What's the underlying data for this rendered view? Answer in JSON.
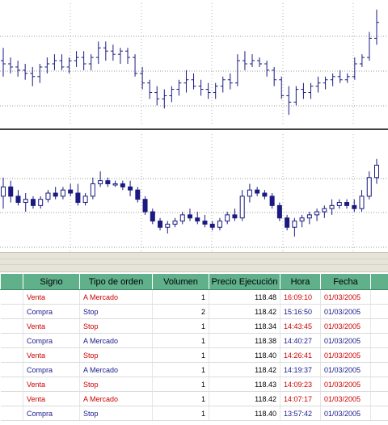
{
  "colors": {
    "header_bg": "#60b08c",
    "venta": "#cc0000",
    "compra": "#1a1a8c",
    "bar_color": "#1a1a80",
    "grid": "#9a9a9a",
    "divider": "#000000"
  },
  "chart_data": [
    {
      "type": "ohlc",
      "grid": true,
      "candles": [
        {
          "open": 118.32,
          "high": 118.36,
          "low": 118.27,
          "close": 118.31
        },
        {
          "open": 118.31,
          "high": 118.33,
          "low": 118.28,
          "close": 118.3
        },
        {
          "open": 118.3,
          "high": 118.32,
          "low": 118.27,
          "close": 118.29
        },
        {
          "open": 118.29,
          "high": 118.31,
          "low": 118.26,
          "close": 118.28
        },
        {
          "open": 118.28,
          "high": 118.3,
          "low": 118.24,
          "close": 118.27
        },
        {
          "open": 118.27,
          "high": 118.31,
          "low": 118.25,
          "close": 118.3
        },
        {
          "open": 118.3,
          "high": 118.33,
          "low": 118.28,
          "close": 118.31
        },
        {
          "open": 118.31,
          "high": 118.34,
          "low": 118.29,
          "close": 118.32
        },
        {
          "open": 118.32,
          "high": 118.34,
          "low": 118.29,
          "close": 118.3
        },
        {
          "open": 118.3,
          "high": 118.33,
          "low": 118.28,
          "close": 118.32
        },
        {
          "open": 118.32,
          "high": 118.35,
          "low": 118.3,
          "close": 118.33
        },
        {
          "open": 118.33,
          "high": 118.35,
          "low": 118.29,
          "close": 118.31
        },
        {
          "open": 118.31,
          "high": 118.34,
          "low": 118.29,
          "close": 118.33
        },
        {
          "open": 118.33,
          "high": 118.38,
          "low": 118.31,
          "close": 118.36
        },
        {
          "open": 118.36,
          "high": 118.38,
          "low": 118.32,
          "close": 118.35
        },
        {
          "open": 118.35,
          "high": 118.37,
          "low": 118.32,
          "close": 118.34
        },
        {
          "open": 118.34,
          "high": 118.36,
          "low": 118.31,
          "close": 118.35
        },
        {
          "open": 118.35,
          "high": 118.36,
          "low": 118.31,
          "close": 118.33
        },
        {
          "open": 118.33,
          "high": 118.34,
          "low": 118.27,
          "close": 118.28
        },
        {
          "open": 118.28,
          "high": 118.3,
          "low": 118.23,
          "close": 118.25
        },
        {
          "open": 118.25,
          "high": 118.26,
          "low": 118.2,
          "close": 118.22
        },
        {
          "open": 118.22,
          "high": 118.24,
          "low": 118.18,
          "close": 118.2
        },
        {
          "open": 118.2,
          "high": 118.23,
          "low": 118.17,
          "close": 118.21
        },
        {
          "open": 118.21,
          "high": 118.24,
          "low": 118.19,
          "close": 118.23
        },
        {
          "open": 118.23,
          "high": 118.26,
          "low": 118.21,
          "close": 118.25
        },
        {
          "open": 118.25,
          "high": 118.29,
          "low": 118.22,
          "close": 118.26
        },
        {
          "open": 118.26,
          "high": 118.28,
          "low": 118.23,
          "close": 118.24
        },
        {
          "open": 118.24,
          "high": 118.26,
          "low": 118.21,
          "close": 118.23
        },
        {
          "open": 118.23,
          "high": 118.25,
          "low": 118.2,
          "close": 118.22
        },
        {
          "open": 118.22,
          "high": 118.25,
          "low": 118.2,
          "close": 118.24
        },
        {
          "open": 118.24,
          "high": 118.27,
          "low": 118.22,
          "close": 118.26
        },
        {
          "open": 118.26,
          "high": 118.28,
          "low": 118.23,
          "close": 118.25
        },
        {
          "open": 118.25,
          "high": 118.34,
          "low": 118.24,
          "close": 118.32
        },
        {
          "open": 118.32,
          "high": 118.35,
          "low": 118.29,
          "close": 118.31
        },
        {
          "open": 118.31,
          "high": 118.34,
          "low": 118.3,
          "close": 118.32
        },
        {
          "open": 118.32,
          "high": 118.33,
          "low": 118.3,
          "close": 118.31
        },
        {
          "open": 118.31,
          "high": 118.32,
          "low": 118.27,
          "close": 118.29
        },
        {
          "open": 118.29,
          "high": 118.3,
          "low": 118.24,
          "close": 118.26
        },
        {
          "open": 118.26,
          "high": 118.27,
          "low": 118.2,
          "close": 118.21
        },
        {
          "open": 118.21,
          "high": 118.24,
          "low": 118.15,
          "close": 118.19
        },
        {
          "open": 118.19,
          "high": 118.24,
          "low": 118.18,
          "close": 118.23
        },
        {
          "open": 118.23,
          "high": 118.25,
          "low": 118.2,
          "close": 118.22
        },
        {
          "open": 118.22,
          "high": 118.25,
          "low": 118.2,
          "close": 118.24
        },
        {
          "open": 118.24,
          "high": 118.27,
          "low": 118.22,
          "close": 118.25
        },
        {
          "open": 118.25,
          "high": 118.27,
          "low": 118.23,
          "close": 118.26
        },
        {
          "open": 118.26,
          "high": 118.28,
          "low": 118.24,
          "close": 118.27
        },
        {
          "open": 118.27,
          "high": 118.29,
          "low": 118.25,
          "close": 118.26
        },
        {
          "open": 118.26,
          "high": 118.28,
          "low": 118.25,
          "close": 118.27
        },
        {
          "open": 118.27,
          "high": 118.33,
          "low": 118.26,
          "close": 118.31
        },
        {
          "open": 118.31,
          "high": 118.34,
          "low": 118.3,
          "close": 118.33
        },
        {
          "open": 118.33,
          "high": 118.41,
          "low": 118.32,
          "close": 118.39
        },
        {
          "open": 118.39,
          "high": 118.48,
          "low": 118.37,
          "close": 118.44
        }
      ]
    },
    {
      "type": "candlestick",
      "grid": true,
      "candles": [
        {
          "open": 118.3,
          "high": 118.36,
          "low": 118.26,
          "close": 118.33
        },
        {
          "open": 118.33,
          "high": 118.35,
          "low": 118.28,
          "close": 118.3
        },
        {
          "open": 118.3,
          "high": 118.32,
          "low": 118.27,
          "close": 118.28
        },
        {
          "open": 118.28,
          "high": 118.31,
          "low": 118.25,
          "close": 118.29
        },
        {
          "open": 118.29,
          "high": 118.3,
          "low": 118.26,
          "close": 118.27
        },
        {
          "open": 118.27,
          "high": 118.3,
          "low": 118.26,
          "close": 118.29
        },
        {
          "open": 118.29,
          "high": 118.32,
          "low": 118.28,
          "close": 118.31
        },
        {
          "open": 118.31,
          "high": 118.33,
          "low": 118.29,
          "close": 118.3
        },
        {
          "open": 118.3,
          "high": 118.33,
          "low": 118.29,
          "close": 118.32
        },
        {
          "open": 118.32,
          "high": 118.34,
          "low": 118.3,
          "close": 118.31
        },
        {
          "open": 118.31,
          "high": 118.34,
          "low": 118.27,
          "close": 118.28
        },
        {
          "open": 118.28,
          "high": 118.31,
          "low": 118.27,
          "close": 118.3
        },
        {
          "open": 118.3,
          "high": 118.36,
          "low": 118.29,
          "close": 118.34
        },
        {
          "open": 118.34,
          "high": 118.38,
          "low": 118.33,
          "close": 118.35
        },
        {
          "open": 118.35,
          "high": 118.36,
          "low": 118.33,
          "close": 118.34
        },
        {
          "open": 118.34,
          "high": 118.35,
          "low": 118.33,
          "close": 118.34
        },
        {
          "open": 118.34,
          "high": 118.35,
          "low": 118.32,
          "close": 118.33
        },
        {
          "open": 118.33,
          "high": 118.35,
          "low": 118.3,
          "close": 118.32
        },
        {
          "open": 118.32,
          "high": 118.33,
          "low": 118.28,
          "close": 118.29
        },
        {
          "open": 118.29,
          "high": 118.3,
          "low": 118.24,
          "close": 118.25
        },
        {
          "open": 118.25,
          "high": 118.26,
          "low": 118.21,
          "close": 118.22
        },
        {
          "open": 118.22,
          "high": 118.23,
          "low": 118.19,
          "close": 118.2
        },
        {
          "open": 118.2,
          "high": 118.22,
          "low": 118.18,
          "close": 118.21
        },
        {
          "open": 118.21,
          "high": 118.23,
          "low": 118.2,
          "close": 118.22
        },
        {
          "open": 118.22,
          "high": 118.25,
          "low": 118.21,
          "close": 118.24
        },
        {
          "open": 118.24,
          "high": 118.26,
          "low": 118.22,
          "close": 118.23
        },
        {
          "open": 118.23,
          "high": 118.25,
          "low": 118.21,
          "close": 118.22
        },
        {
          "open": 118.22,
          "high": 118.24,
          "low": 118.2,
          "close": 118.21
        },
        {
          "open": 118.21,
          "high": 118.22,
          "low": 118.19,
          "close": 118.2
        },
        {
          "open": 118.2,
          "high": 118.23,
          "low": 118.19,
          "close": 118.22
        },
        {
          "open": 118.22,
          "high": 118.25,
          "low": 118.21,
          "close": 118.24
        },
        {
          "open": 118.24,
          "high": 118.26,
          "low": 118.22,
          "close": 118.23
        },
        {
          "open": 118.23,
          "high": 118.32,
          "low": 118.22,
          "close": 118.3
        },
        {
          "open": 118.3,
          "high": 118.34,
          "low": 118.28,
          "close": 118.32
        },
        {
          "open": 118.32,
          "high": 118.33,
          "low": 118.3,
          "close": 118.31
        },
        {
          "open": 118.31,
          "high": 118.32,
          "low": 118.29,
          "close": 118.3
        },
        {
          "open": 118.3,
          "high": 118.31,
          "low": 118.26,
          "close": 118.27
        },
        {
          "open": 118.27,
          "high": 118.28,
          "low": 118.22,
          "close": 118.23
        },
        {
          "open": 118.23,
          "high": 118.24,
          "low": 118.19,
          "close": 118.2
        },
        {
          "open": 118.2,
          "high": 118.23,
          "low": 118.17,
          "close": 118.22
        },
        {
          "open": 118.22,
          "high": 118.24,
          "low": 118.2,
          "close": 118.23
        },
        {
          "open": 118.23,
          "high": 118.25,
          "low": 118.21,
          "close": 118.24
        },
        {
          "open": 118.24,
          "high": 118.26,
          "low": 118.22,
          "close": 118.25
        },
        {
          "open": 118.25,
          "high": 118.27,
          "low": 118.23,
          "close": 118.26
        },
        {
          "open": 118.26,
          "high": 118.29,
          "low": 118.24,
          "close": 118.27
        },
        {
          "open": 118.27,
          "high": 118.29,
          "low": 118.26,
          "close": 118.28
        },
        {
          "open": 118.28,
          "high": 118.29,
          "low": 118.26,
          "close": 118.27
        },
        {
          "open": 118.27,
          "high": 118.29,
          "low": 118.25,
          "close": 118.26
        },
        {
          "open": 118.26,
          "high": 118.32,
          "low": 118.25,
          "close": 118.3
        },
        {
          "open": 118.3,
          "high": 118.38,
          "low": 118.29,
          "close": 118.36
        },
        {
          "open": 118.36,
          "high": 118.42,
          "low": 118.34,
          "close": 118.4
        }
      ]
    }
  ],
  "orders": {
    "columns": [
      "",
      "Signo",
      "Tipo de orden",
      "Volumen",
      "Precio Ejecución",
      "Hora",
      "Fecha",
      ""
    ],
    "rows": [
      {
        "signo": "Venta",
        "tipo": "A Mercado",
        "volumen": "1",
        "precio": "118.48",
        "hora": "16:09:10",
        "fecha": "01/03/2005"
      },
      {
        "signo": "Compra",
        "tipo": "Stop",
        "volumen": "2",
        "precio": "118.42",
        "hora": "15:16:50",
        "fecha": "01/03/2005"
      },
      {
        "signo": "Venta",
        "tipo": "Stop",
        "volumen": "1",
        "precio": "118.34",
        "hora": "14:43:45",
        "fecha": "01/03/2005"
      },
      {
        "signo": "Compra",
        "tipo": "A Mercado",
        "volumen": "1",
        "precio": "118.38",
        "hora": "14:40:27",
        "fecha": "01/03/2005"
      },
      {
        "signo": "Venta",
        "tipo": "Stop",
        "volumen": "1",
        "precio": "118.40",
        "hora": "14:26:41",
        "fecha": "01/03/2005"
      },
      {
        "signo": "Compra",
        "tipo": "A Mercado",
        "volumen": "1",
        "precio": "118.42",
        "hora": "14:19:37",
        "fecha": "01/03/2005"
      },
      {
        "signo": "Venta",
        "tipo": "Stop",
        "volumen": "1",
        "precio": "118.43",
        "hora": "14:09:23",
        "fecha": "01/03/2005"
      },
      {
        "signo": "Venta",
        "tipo": "A Mercado",
        "volumen": "1",
        "precio": "118.42",
        "hora": "14:07:17",
        "fecha": "01/03/2005"
      },
      {
        "signo": "Compra",
        "tipo": "Stop",
        "volumen": "1",
        "precio": "118.40",
        "hora": "13:57:42",
        "fecha": "01/03/2005"
      }
    ]
  }
}
